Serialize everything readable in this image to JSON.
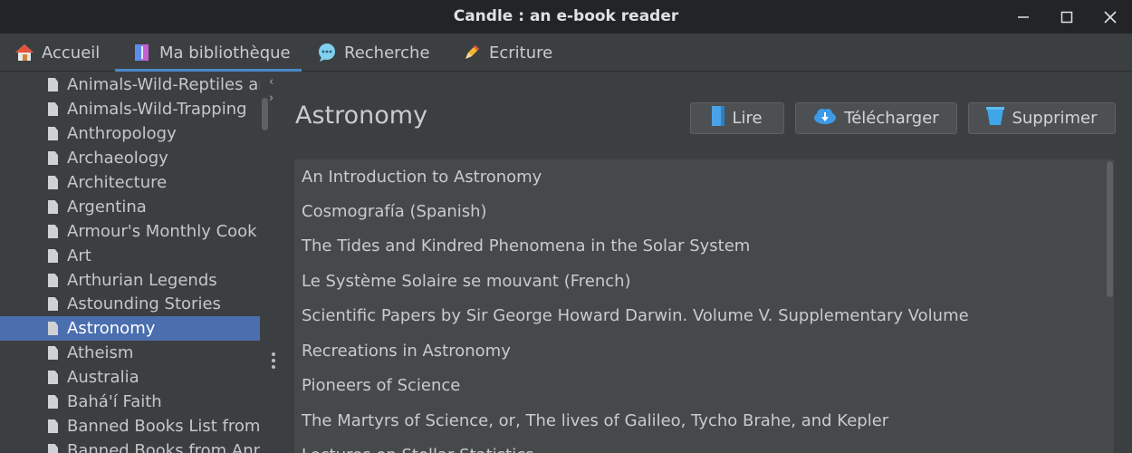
{
  "window": {
    "title": "Candle : an e-book reader"
  },
  "tabs": [
    {
      "label": "Accueil",
      "icon": "home-icon"
    },
    {
      "label": "Ma bibliothèque",
      "icon": "books-icon"
    },
    {
      "label": "Recherche",
      "icon": "search-bubble-icon"
    },
    {
      "label": "Ecriture",
      "icon": "pencil-icon"
    }
  ],
  "active_tab": "Ma bibliothèque",
  "sidebar": {
    "items": [
      "Animals-Wild-Reptiles and Amphibians",
      "Animals-Wild-Trapping",
      "Anthropology",
      "Archaeology",
      "Architecture",
      "Argentina",
      "Armour's Monthly Cook Book",
      "Art",
      "Arthurian Legends",
      "Astounding Stories",
      "Astronomy",
      "Atheism",
      "Australia",
      "Bahá'í Faith",
      "Banned Books List from the American Library Association",
      "Banned Books from Anne Haight's list"
    ],
    "selected": "Astronomy"
  },
  "content": {
    "heading": "Astronomy",
    "buttons": {
      "read": "Lire",
      "download": "Télécharger",
      "delete": "Supprimer"
    },
    "books": [
      "An Introduction to Astronomy",
      "Cosmografía (Spanish)",
      "The Tides and Kindred Phenomena in the Solar System",
      "Le Système Solaire se mouvant (French)",
      "Scientific Papers by Sir George Howard Darwin. Volume V. Supplementary Volume",
      "Recreations in Astronomy",
      "Pioneers of Science",
      "The Martyrs of Science, or, The lives of Galileo, Tycho Brahe, and Kepler",
      "Lectures on Stellar Statistics"
    ]
  },
  "colors": {
    "selection": "#4b6eaf",
    "accent_underline": "#4a88c7",
    "titlebar": "#232428",
    "panel": "#3c3f41",
    "list_bg": "#45494a"
  }
}
